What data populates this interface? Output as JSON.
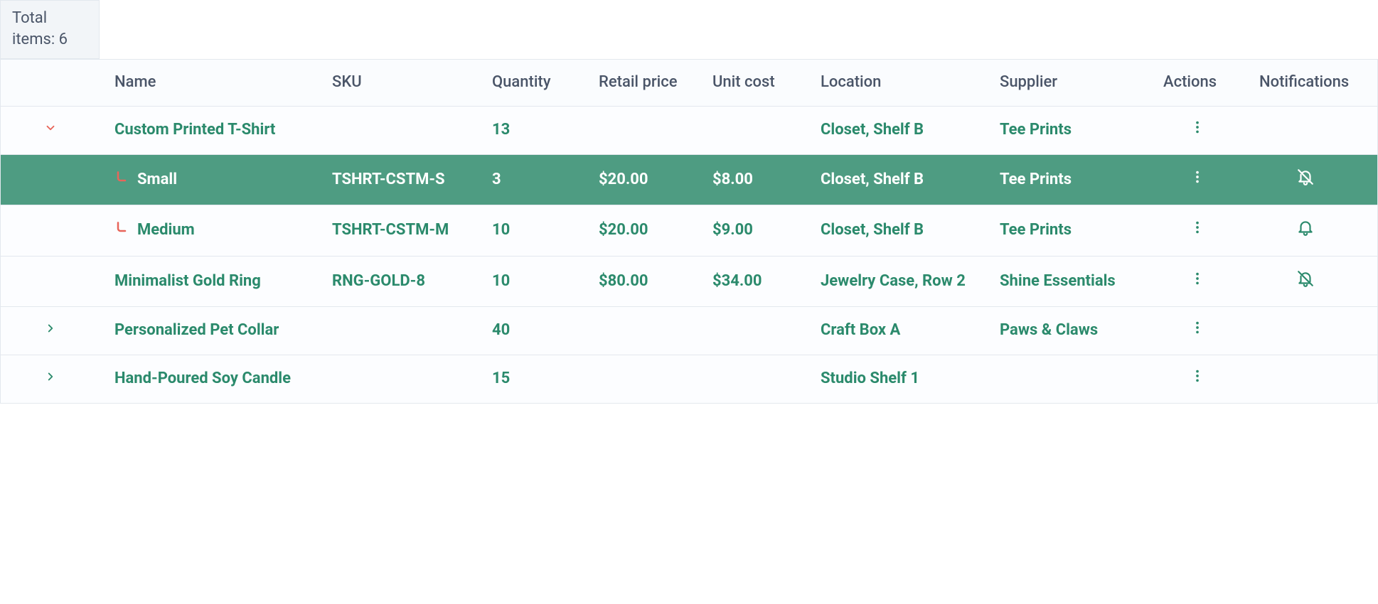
{
  "total_label": "Total items: 6",
  "headers": {
    "name": "Name",
    "sku": "SKU",
    "quantity": "Quantity",
    "retail_price": "Retail price",
    "unit_cost": "Unit cost",
    "location": "Location",
    "supplier": "Supplier",
    "actions": "Actions",
    "notifications": "Notifications"
  },
  "rows": [
    {
      "expand": "down",
      "child": false,
      "name": "Custom Printed T-Shirt",
      "sku": "",
      "quantity": "13",
      "retail_price": "",
      "unit_cost": "",
      "location": "Closet, Shelf B",
      "supplier": "Tee Prints",
      "actions": true,
      "notification": "none",
      "selected": false
    },
    {
      "expand": "",
      "child": true,
      "name": "Small",
      "sku": "TSHRT-CSTM-S",
      "quantity": "3",
      "retail_price": "$20.00",
      "unit_cost": "$8.00",
      "location": "Closet, Shelf B",
      "supplier": "Tee Prints",
      "actions": true,
      "notification": "bell-off",
      "selected": true
    },
    {
      "expand": "",
      "child": true,
      "name": "Medium",
      "sku": "TSHRT-CSTM-M",
      "quantity": "10",
      "retail_price": "$20.00",
      "unit_cost": "$9.00",
      "location": "Closet, Shelf B",
      "supplier": "Tee Prints",
      "actions": true,
      "notification": "bell",
      "selected": false
    },
    {
      "expand": "",
      "child": false,
      "name": "Minimalist Gold Ring",
      "sku": "RNG-GOLD-8",
      "quantity": "10",
      "retail_price": "$80.00",
      "unit_cost": "$34.00",
      "location": "Jewelry Case, Row 2",
      "supplier": "Shine Essentials",
      "actions": true,
      "notification": "bell-off",
      "selected": false
    },
    {
      "expand": "right",
      "child": false,
      "name": "Personalized Pet Collar",
      "sku": "",
      "quantity": "40",
      "retail_price": "",
      "unit_cost": "",
      "location": "Craft Box A",
      "supplier": "Paws & Claws",
      "actions": true,
      "notification": "none",
      "selected": false
    },
    {
      "expand": "right",
      "child": false,
      "name": "Hand-Poured Soy Candle",
      "sku": "",
      "quantity": "15",
      "retail_price": "",
      "unit_cost": "",
      "location": "Studio Shelf 1",
      "supplier": "",
      "actions": true,
      "notification": "none",
      "selected": false
    }
  ]
}
